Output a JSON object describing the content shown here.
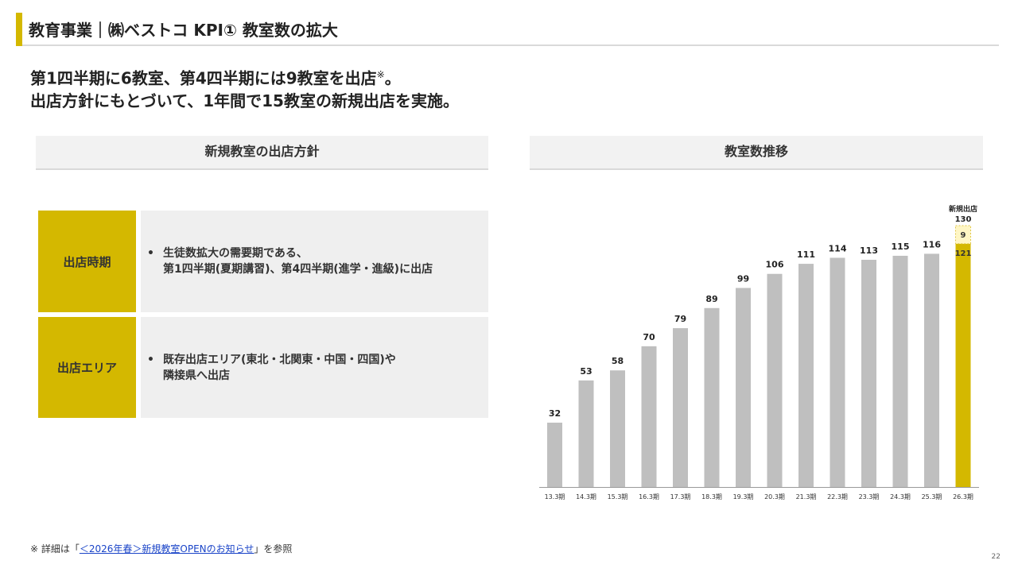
{
  "header": {
    "title": "教育事業｜㈱ベストコ KPI① 教室数の拡大"
  },
  "lead": {
    "line1": "第1四半期に6教室、第4四半期には9教室を出店",
    "line1_mark": "※",
    "line1_end": "。",
    "line2": "出店方針にもとづいて、1年間で15教室の新規出店を実施。"
  },
  "policy": {
    "heading": "新規教室の出店方針",
    "rows": [
      {
        "label": "出店時期",
        "bullet": "•",
        "text_1": "生徒数拡大の需要期である、",
        "text_2": "第1四半期(夏期講習)、第4四半期(進学・進級)に出店"
      },
      {
        "label": "出店エリア",
        "bullet": "•",
        "text_1": "既存出店エリア(東北・北関東・中国・四国)や",
        "text_2": "隣接県へ出店"
      }
    ]
  },
  "chart_panel": {
    "heading": "教室数推移"
  },
  "chart_data": {
    "type": "bar",
    "categories": [
      "13.3期",
      "14.3期",
      "15.3期",
      "16.3期",
      "17.3期",
      "18.3期",
      "19.3期",
      "20.3期",
      "21.3期",
      "22.3期",
      "23.3期",
      "24.3期",
      "25.3期",
      "26.3期"
    ],
    "series": [
      {
        "values": [
          32,
          53,
          58,
          70,
          79,
          89,
          99,
          106,
          111,
          114,
          113,
          115,
          116,
          121
        ]
      },
      {
        "name": "新規出店",
        "values": [
          0,
          0,
          0,
          0,
          0,
          0,
          0,
          0,
          0,
          0,
          0,
          0,
          0,
          9
        ]
      }
    ],
    "totals": [
      32,
      53,
      58,
      70,
      79,
      89,
      99,
      106,
      111,
      114,
      113,
      115,
      116,
      130
    ],
    "legend_label": "新規出店",
    "stacked": true,
    "ylim": [
      0,
      130
    ],
    "title": "",
    "xlabel": "",
    "ylabel": "",
    "grid": false,
    "colors": {
      "base": "#bfbfbf",
      "highlight": "#d4b800",
      "new": "#fff6c4",
      "new_border": "#e0c84a"
    }
  },
  "footnote": {
    "prefix": "※ 詳細は「",
    "link": "＜2026年春＞新規教室OPENのお知らせ",
    "suffix": "」を参照"
  },
  "page_number": "22"
}
